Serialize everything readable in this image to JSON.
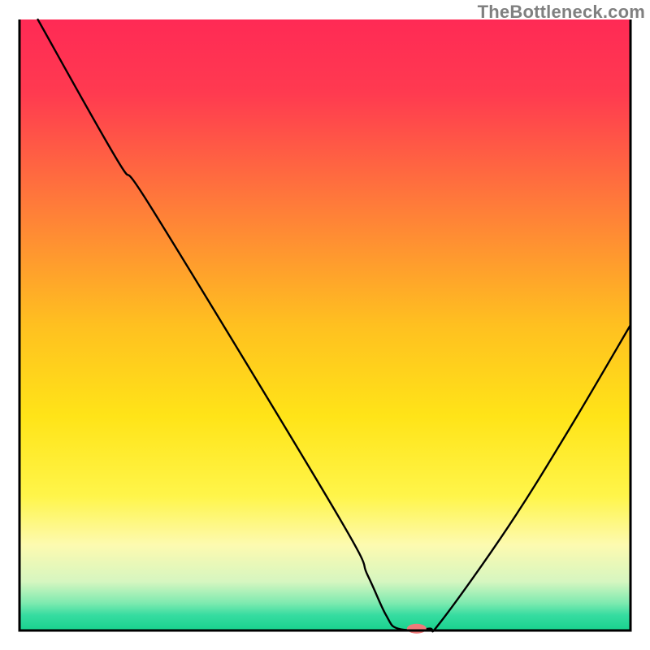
{
  "watermark": "TheBottleneck.com",
  "chart_data": {
    "type": "line",
    "title": "",
    "xlabel": "",
    "ylabel": "",
    "xlim": [
      0,
      100
    ],
    "ylim": [
      0,
      100
    ],
    "gradient_stops": [
      {
        "offset": 0.0,
        "color": "#ff2a55"
      },
      {
        "offset": 0.12,
        "color": "#ff3a50"
      },
      {
        "offset": 0.3,
        "color": "#ff7a3a"
      },
      {
        "offset": 0.5,
        "color": "#ffc020"
      },
      {
        "offset": 0.65,
        "color": "#ffe418"
      },
      {
        "offset": 0.78,
        "color": "#fff54a"
      },
      {
        "offset": 0.86,
        "color": "#fdfab0"
      },
      {
        "offset": 0.92,
        "color": "#d6f6c0"
      },
      {
        "offset": 0.955,
        "color": "#7eeab0"
      },
      {
        "offset": 0.975,
        "color": "#36dca0"
      },
      {
        "offset": 1.0,
        "color": "#18d28e"
      }
    ],
    "series": [
      {
        "name": "bottleneck-curve",
        "points": [
          {
            "x": 3.0,
            "y": 100.0
          },
          {
            "x": 16.0,
            "y": 77.0
          },
          {
            "x": 22.0,
            "y": 68.5
          },
          {
            "x": 52.0,
            "y": 19.0
          },
          {
            "x": 57.0,
            "y": 9.0
          },
          {
            "x": 60.0,
            "y": 2.5
          },
          {
            "x": 62.0,
            "y": 0.3
          },
          {
            "x": 67.0,
            "y": 0.3
          },
          {
            "x": 69.0,
            "y": 1.5
          },
          {
            "x": 80.0,
            "y": 17.0
          },
          {
            "x": 90.0,
            "y": 33.0
          },
          {
            "x": 100.0,
            "y": 50.0
          }
        ]
      }
    ],
    "marker": {
      "x": 65.0,
      "y": 0.3,
      "color": "#ef7a7a",
      "rx": 12,
      "ry": 6
    },
    "frame_color": "#000000"
  }
}
